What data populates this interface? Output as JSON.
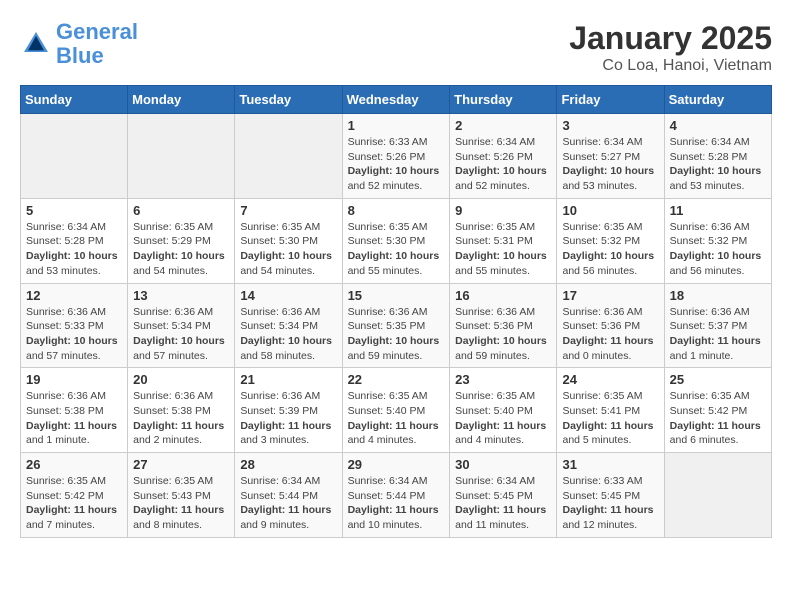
{
  "header": {
    "logo_line1": "General",
    "logo_line2": "Blue",
    "title": "January 2025",
    "subtitle": "Co Loa, Hanoi, Vietnam"
  },
  "calendar": {
    "days_of_week": [
      "Sunday",
      "Monday",
      "Tuesday",
      "Wednesday",
      "Thursday",
      "Friday",
      "Saturday"
    ],
    "weeks": [
      [
        {
          "day": "",
          "info": ""
        },
        {
          "day": "",
          "info": ""
        },
        {
          "day": "",
          "info": ""
        },
        {
          "day": "1",
          "info": "Sunrise: 6:33 AM\nSunset: 5:26 PM\nDaylight: 10 hours\nand 52 minutes."
        },
        {
          "day": "2",
          "info": "Sunrise: 6:34 AM\nSunset: 5:26 PM\nDaylight: 10 hours\nand 52 minutes."
        },
        {
          "day": "3",
          "info": "Sunrise: 6:34 AM\nSunset: 5:27 PM\nDaylight: 10 hours\nand 53 minutes."
        },
        {
          "day": "4",
          "info": "Sunrise: 6:34 AM\nSunset: 5:28 PM\nDaylight: 10 hours\nand 53 minutes."
        }
      ],
      [
        {
          "day": "5",
          "info": "Sunrise: 6:34 AM\nSunset: 5:28 PM\nDaylight: 10 hours\nand 53 minutes."
        },
        {
          "day": "6",
          "info": "Sunrise: 6:35 AM\nSunset: 5:29 PM\nDaylight: 10 hours\nand 54 minutes."
        },
        {
          "day": "7",
          "info": "Sunrise: 6:35 AM\nSunset: 5:30 PM\nDaylight: 10 hours\nand 54 minutes."
        },
        {
          "day": "8",
          "info": "Sunrise: 6:35 AM\nSunset: 5:30 PM\nDaylight: 10 hours\nand 55 minutes."
        },
        {
          "day": "9",
          "info": "Sunrise: 6:35 AM\nSunset: 5:31 PM\nDaylight: 10 hours\nand 55 minutes."
        },
        {
          "day": "10",
          "info": "Sunrise: 6:35 AM\nSunset: 5:32 PM\nDaylight: 10 hours\nand 56 minutes."
        },
        {
          "day": "11",
          "info": "Sunrise: 6:36 AM\nSunset: 5:32 PM\nDaylight: 10 hours\nand 56 minutes."
        }
      ],
      [
        {
          "day": "12",
          "info": "Sunrise: 6:36 AM\nSunset: 5:33 PM\nDaylight: 10 hours\nand 57 minutes."
        },
        {
          "day": "13",
          "info": "Sunrise: 6:36 AM\nSunset: 5:34 PM\nDaylight: 10 hours\nand 57 minutes."
        },
        {
          "day": "14",
          "info": "Sunrise: 6:36 AM\nSunset: 5:34 PM\nDaylight: 10 hours\nand 58 minutes."
        },
        {
          "day": "15",
          "info": "Sunrise: 6:36 AM\nSunset: 5:35 PM\nDaylight: 10 hours\nand 59 minutes."
        },
        {
          "day": "16",
          "info": "Sunrise: 6:36 AM\nSunset: 5:36 PM\nDaylight: 10 hours\nand 59 minutes."
        },
        {
          "day": "17",
          "info": "Sunrise: 6:36 AM\nSunset: 5:36 PM\nDaylight: 11 hours\nand 0 minutes."
        },
        {
          "day": "18",
          "info": "Sunrise: 6:36 AM\nSunset: 5:37 PM\nDaylight: 11 hours\nand 1 minute."
        }
      ],
      [
        {
          "day": "19",
          "info": "Sunrise: 6:36 AM\nSunset: 5:38 PM\nDaylight: 11 hours\nand 1 minute."
        },
        {
          "day": "20",
          "info": "Sunrise: 6:36 AM\nSunset: 5:38 PM\nDaylight: 11 hours\nand 2 minutes."
        },
        {
          "day": "21",
          "info": "Sunrise: 6:36 AM\nSunset: 5:39 PM\nDaylight: 11 hours\nand 3 minutes."
        },
        {
          "day": "22",
          "info": "Sunrise: 6:35 AM\nSunset: 5:40 PM\nDaylight: 11 hours\nand 4 minutes."
        },
        {
          "day": "23",
          "info": "Sunrise: 6:35 AM\nSunset: 5:40 PM\nDaylight: 11 hours\nand 4 minutes."
        },
        {
          "day": "24",
          "info": "Sunrise: 6:35 AM\nSunset: 5:41 PM\nDaylight: 11 hours\nand 5 minutes."
        },
        {
          "day": "25",
          "info": "Sunrise: 6:35 AM\nSunset: 5:42 PM\nDaylight: 11 hours\nand 6 minutes."
        }
      ],
      [
        {
          "day": "26",
          "info": "Sunrise: 6:35 AM\nSunset: 5:42 PM\nDaylight: 11 hours\nand 7 minutes."
        },
        {
          "day": "27",
          "info": "Sunrise: 6:35 AM\nSunset: 5:43 PM\nDaylight: 11 hours\nand 8 minutes."
        },
        {
          "day": "28",
          "info": "Sunrise: 6:34 AM\nSunset: 5:44 PM\nDaylight: 11 hours\nand 9 minutes."
        },
        {
          "day": "29",
          "info": "Sunrise: 6:34 AM\nSunset: 5:44 PM\nDaylight: 11 hours\nand 10 minutes."
        },
        {
          "day": "30",
          "info": "Sunrise: 6:34 AM\nSunset: 5:45 PM\nDaylight: 11 hours\nand 11 minutes."
        },
        {
          "day": "31",
          "info": "Sunrise: 6:33 AM\nSunset: 5:45 PM\nDaylight: 11 hours\nand 12 minutes."
        },
        {
          "day": "",
          "info": ""
        }
      ]
    ]
  }
}
